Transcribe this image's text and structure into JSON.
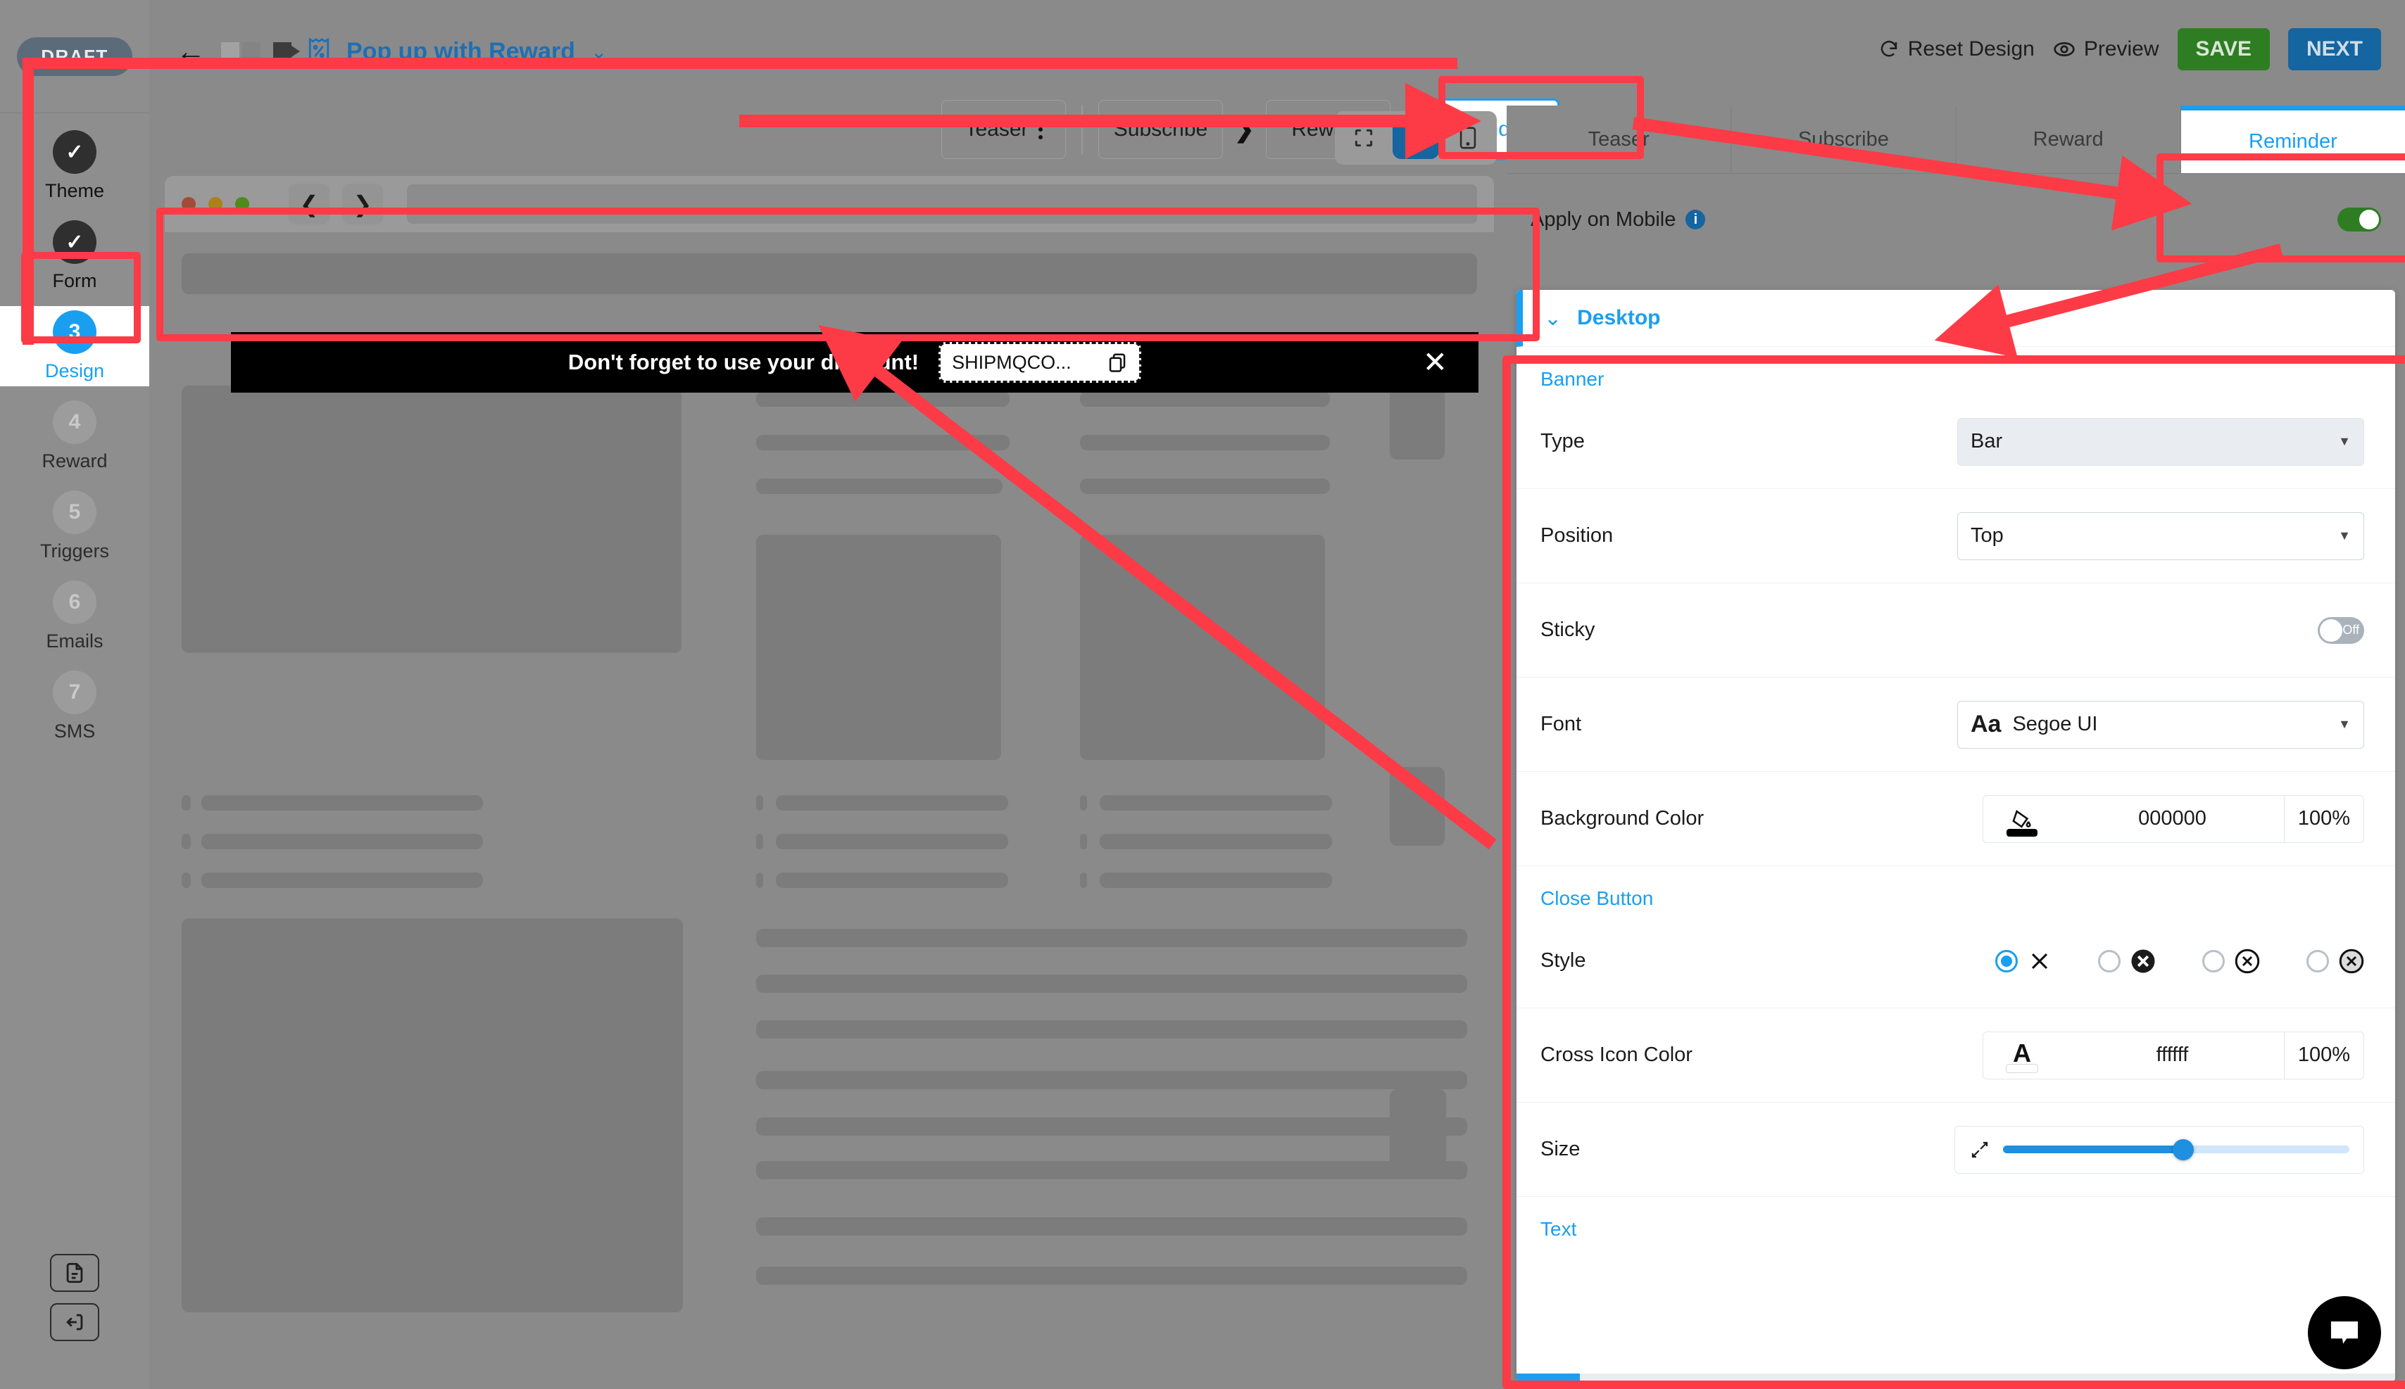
{
  "app": {
    "status_badge": "DRAFT",
    "document_title": "Pop up with Reward",
    "back_icon": "back-arrow-icon",
    "title_caret": "⌄"
  },
  "sidebar": {
    "steps": [
      {
        "num": "✓",
        "label": "Theme",
        "state": "done"
      },
      {
        "num": "✓",
        "label": "Form",
        "state": "done"
      },
      {
        "num": "3",
        "label": "Design",
        "state": "active"
      },
      {
        "num": "4",
        "label": "Reward",
        "state": "pending"
      },
      {
        "num": "5",
        "label": "Triggers",
        "state": "pending"
      },
      {
        "num": "6",
        "label": "Emails",
        "state": "pending"
      },
      {
        "num": "7",
        "label": "SMS",
        "state": "pending"
      }
    ],
    "bottom_buttons": [
      "document-icon",
      "logout-icon"
    ]
  },
  "topbar": {
    "reset_label": "Reset Design",
    "reset_icon": "refresh-icon",
    "preview_label": "Preview",
    "preview_icon": "eye-icon",
    "save_label": "SAVE",
    "next_label": "NEXT",
    "save_color": "#2e7d23",
    "next_color": "#1565a0"
  },
  "editor": {
    "tabs": [
      {
        "label": "Teaser",
        "kebab": true,
        "selected": false
      },
      {
        "label": "Subscribe",
        "kebab": false,
        "selected": false
      },
      {
        "label": "Reward",
        "kebab": false,
        "selected": false
      },
      {
        "label": "Reminder",
        "kebab": true,
        "selected": true
      }
    ],
    "step_chevron": "❯",
    "device_buttons": [
      {
        "name": "fullscreen-icon",
        "active": false
      },
      {
        "name": "desktop-icon",
        "active": true
      },
      {
        "name": "mobile-icon",
        "active": false
      }
    ]
  },
  "preview": {
    "browser_dots": [
      "#a14c38",
      "#ab8119",
      "#4f8a1c"
    ],
    "nav_back": "❮",
    "nav_forward": "❯",
    "banner": {
      "message": "Don't forget to use your discount!",
      "coupon_code": "SHIPMQCO...",
      "copy_icon": "copy-icon",
      "close_icon": "close-x-icon",
      "background": "#000000",
      "text_color": "#ffffff"
    }
  },
  "panel": {
    "tabs": [
      {
        "label": "Teaser",
        "selected": false
      },
      {
        "label": "Subscribe",
        "selected": false
      },
      {
        "label": "Reward",
        "selected": false
      },
      {
        "label": "Reminder",
        "selected": true
      }
    ],
    "apply_on_mobile": {
      "label": "Apply on Mobile",
      "info_icon": "info-icon",
      "value": "on"
    },
    "accordion": {
      "title": "Desktop",
      "chevron": "⌄",
      "expanded": true
    },
    "sections": {
      "banner_title": "Banner",
      "close_button_title": "Close Button",
      "text_title": "Text"
    },
    "rows": {
      "type": {
        "label": "Type",
        "value": "Bar",
        "disabled": true
      },
      "position": {
        "label": "Position",
        "value": "Top"
      },
      "sticky": {
        "label": "Sticky",
        "value": "Off"
      },
      "font": {
        "label": "Font",
        "value": "Segoe UI",
        "icon": "Aa"
      },
      "background_color": {
        "label": "Background Color",
        "hex": "000000",
        "opacity": "100%",
        "swatch": "#000000",
        "icon": "paint-bucket-icon"
      },
      "style": {
        "label": "Style",
        "selected_index": 0,
        "options": [
          "plain-x",
          "filled-circle-x",
          "outline-circle-x",
          "gray-circle-x"
        ]
      },
      "cross_icon_color": {
        "label": "Cross Icon Color",
        "hex": "ffffff",
        "opacity": "100%",
        "swatch": "#ffffff",
        "icon": "A"
      },
      "size": {
        "label": "Size",
        "icon": "resize-icon",
        "value_pct": 52
      }
    }
  },
  "colors": {
    "accent_blue": "#1a9ff0",
    "annotation_red": "#fc3b46",
    "save_green": "#2e7d23",
    "next_blue": "#1565a0"
  }
}
